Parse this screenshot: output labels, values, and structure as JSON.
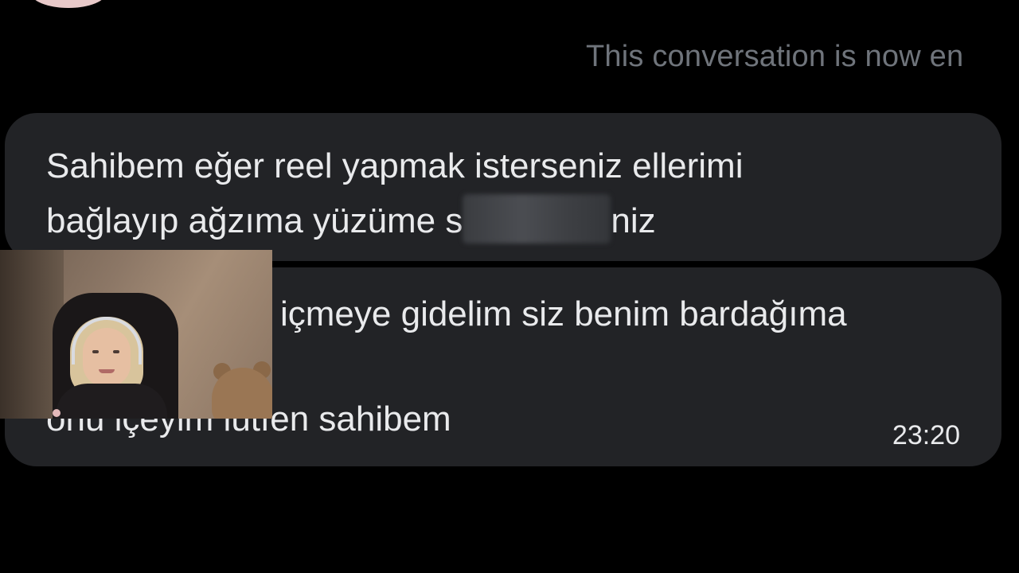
{
  "system_notice": "This conversation is now en",
  "messages": [
    {
      "line1": "Sahibem eğer reel yapmak isterseniz ellerimi",
      "line2_before": "bağlayıp ağzıma yüzüme s",
      "line2_after": "niz"
    },
    {
      "line1": "içmeye gidelim siz benim bardağıma",
      "line3": "onu içeyim lütfen sahibem",
      "time": "23:20"
    }
  ],
  "colors": {
    "background": "#000000",
    "bubble": "#222326",
    "text": "#e9eaec",
    "notice": "#6f747b"
  }
}
